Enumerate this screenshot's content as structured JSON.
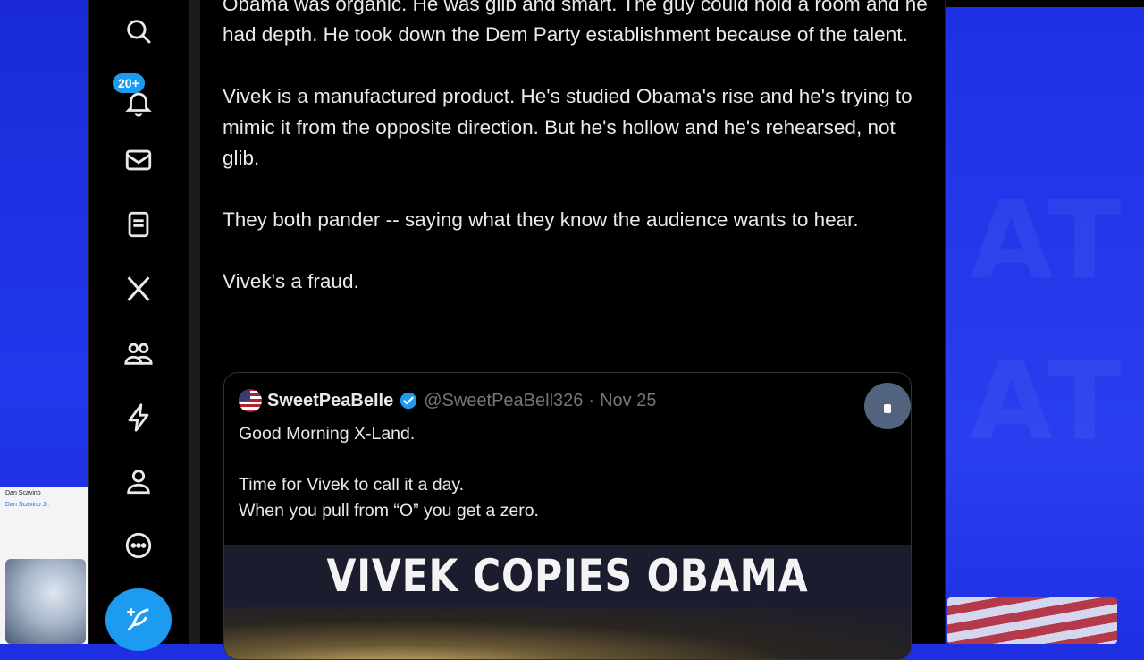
{
  "notifications": {
    "badge": "20+"
  },
  "nav": [
    {
      "id": "search",
      "icon": "search-icon"
    },
    {
      "id": "notifications",
      "icon": "bell-icon"
    },
    {
      "id": "messages",
      "icon": "mail-icon"
    },
    {
      "id": "lists",
      "icon": "list-icon"
    },
    {
      "id": "premium",
      "icon": "x-logo-icon"
    },
    {
      "id": "communities",
      "icon": "people-icon"
    },
    {
      "id": "verified-orgs",
      "icon": "lightning-icon"
    },
    {
      "id": "profile",
      "icon": "person-icon"
    },
    {
      "id": "more",
      "icon": "more-circle-icon"
    },
    {
      "id": "post",
      "icon": "feather-plus-icon"
    }
  ],
  "tweet": {
    "paragraphs": [
      "Obama was organic.  He was glib and smart.  The guy could hold a room and he had depth.  He took down the Dem Party establishment because of the talent.",
      "Vivek is a manufactured product.  He's studied Obama's rise and he's trying to mimic it from the opposite direction.  But he's hollow and he's rehearsed, not glib.",
      "They both pander -- saying what they know the audience wants to hear.",
      "Vivek's a fraud."
    ]
  },
  "quote": {
    "name": "SweetPeaBelle",
    "handle": "@SweetPeaBell326",
    "separator": "·",
    "date": "Nov 25",
    "line1": "Good Morning X-Land.",
    "line2": "Time for Vivek to call it a day.",
    "line3": "When you pull from “O” you get a zero.",
    "media_title": "VIVEK COPIES OBAMA"
  },
  "thumbnail": {
    "line1": "Dan Scavino",
    "line2": "Dan Scavino Jr."
  },
  "colors": {
    "accent": "#1d9bf0",
    "text": "#e7e9ea",
    "muted": "#71767b",
    "background": "#000000",
    "backdrop": "#1d2fe0"
  }
}
